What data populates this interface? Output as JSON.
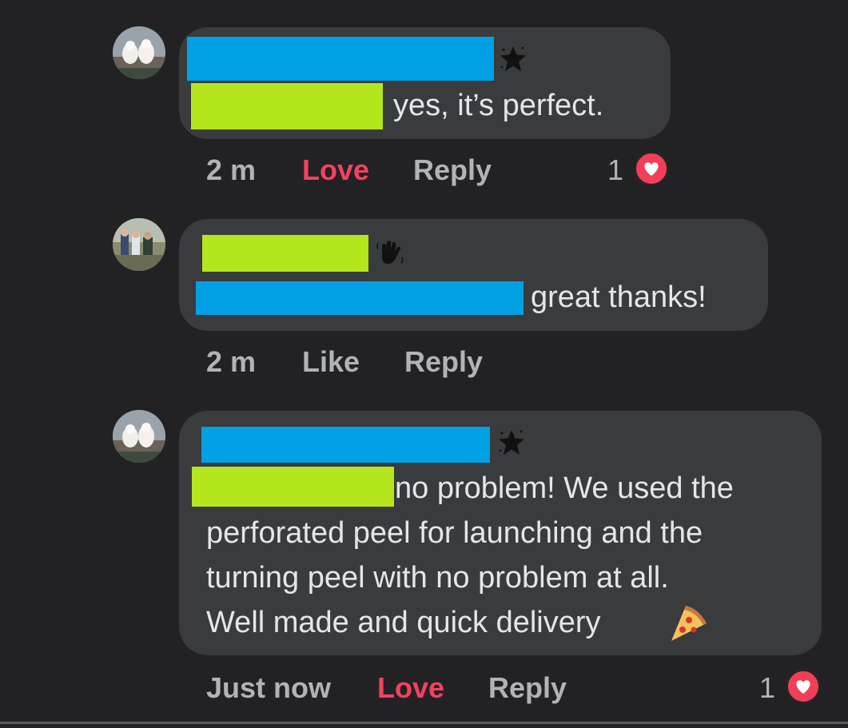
{
  "comments": [
    {
      "message": "yes, it’s perfect.",
      "time": "2 m",
      "react_label": "Love",
      "reply_label": "Reply",
      "reaction_count": "1",
      "reaction_type": "heart-icon",
      "badge": "star-icon"
    },
    {
      "message": "great thanks!",
      "time": "2 m",
      "react_label": "Like",
      "reply_label": "Reply",
      "badge": "wave-hand-icon"
    },
    {
      "message_lines": [
        "no problem! We used the",
        "perforated peel for launching and the",
        "turning peel with no problem at all.",
        "Well made and quick delivery"
      ],
      "emoji": "pizza-icon",
      "time": "Just now",
      "react_label": "Love",
      "reply_label": "Reply",
      "reaction_count": "1",
      "reaction_type": "heart-icon",
      "badge": "star-icon"
    }
  ],
  "colors": {
    "background": "#222225",
    "bubble": "#3a3b3d",
    "love": "#f3425f",
    "redaction_blue": "#00a0e4",
    "redaction_green": "#b5e61d"
  }
}
